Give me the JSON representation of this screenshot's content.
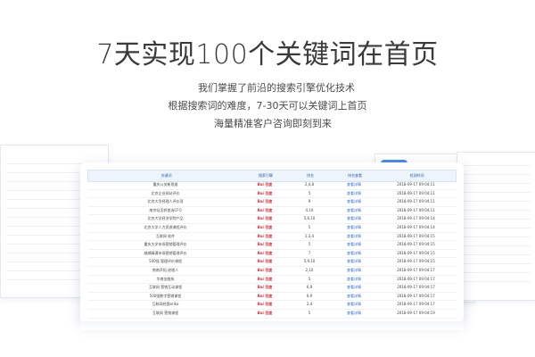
{
  "header": {
    "title": "7天实现100个关键词在首页",
    "subtitle_lines": [
      "我们掌握了前沿的搜索引擎优化技术",
      "根据搜索词的难度，7-30天可以关键词上首页",
      "海量精准客户咨询即刻到来"
    ]
  },
  "table": {
    "headers": [
      "关键词",
      "搜索引擎",
      "排名",
      "排名查看",
      "检测时间"
    ],
    "rows": [
      {
        "keyword": "重庆公关新思维",
        "engine": "Bai 百度",
        "rank": "2,4,8",
        "view": "查看详情",
        "time": "2018-09-17 09:04:11"
      },
      {
        "keyword": "北京企业网站评价",
        "engine": "Bai 百度",
        "rank": "5",
        "view": "查看详情",
        "time": "2018-09-17 09:04:11"
      },
      {
        "keyword": "北京大学经理人评价项",
        "engine": "Bai 百度",
        "rank": "9",
        "view": "查看详情",
        "time": "2018-09-17 09:04:11"
      },
      {
        "keyword": "南京站怎样首选CFO",
        "engine": "Bai 百度",
        "rank": "4,10",
        "view": "查看详情",
        "time": "2018-09-17 09:04:11"
      },
      {
        "keyword": "北京大学经济学院产品",
        "engine": "Bai 百度",
        "rank": "5,6,10",
        "view": "查看详情",
        "time": "2018-09-17 09:04:14"
      },
      {
        "keyword": "北京大学人力资源课程评价",
        "engine": "Bai 百度",
        "rank": "5",
        "view": "查看详情",
        "time": "2018-09-17 09:04:14"
      },
      {
        "keyword": "互联网 软件",
        "engine": "Bai 百度",
        "rank": "1,3,4",
        "view": "查看详情",
        "time": "2018-09-17 09:04:15"
      },
      {
        "keyword": "重庆大学市场营销管理评价",
        "engine": "Bai 百度",
        "rank": "5",
        "view": "查看详情",
        "time": "2018-09-17 09:04:15"
      },
      {
        "keyword": "威威精通市场营销管理评价",
        "engine": "Bai 百度",
        "rank": "7",
        "view": "查看详情",
        "time": "2018-09-17 09:04:15"
      },
      {
        "keyword": "500强 管理评价课程",
        "engine": "Bai 百度",
        "rank": "5,9,10",
        "view": "查看详情",
        "time": "2018-09-17 09:04:15"
      },
      {
        "keyword": "南南开拓 经理人",
        "engine": "Bai 百度",
        "rank": "2,10",
        "view": "查看详情",
        "time": "2018-09-17 09:04:17"
      },
      {
        "keyword": "华南金融系",
        "engine": "Bai 百度",
        "rank": "5",
        "view": "查看详情",
        "time": "2018-09-17 09:04:17"
      },
      {
        "keyword": "互联网 营销互动课程",
        "engine": "Bai 百度",
        "rank": "6,9",
        "view": "查看详情",
        "time": "2018-09-17 09:04:17"
      },
      {
        "keyword": "500强数字营销课程",
        "engine": "Bai 百度",
        "rank": "6,9",
        "view": "查看详情",
        "time": "2018-09-17 09:04:17"
      },
      {
        "keyword": "互联网经营erika",
        "engine": "Bai 百度",
        "rank": "2,4",
        "view": "查看详情",
        "time": "2018-09-17 09:04:17"
      },
      {
        "keyword": "互联网 营销课程",
        "engine": "Bai 百度",
        "rank": "5",
        "view": "查看详情",
        "time": "2018-09-17 09:04:19"
      }
    ]
  },
  "colors": {
    "header_bg": "#eef4fb",
    "header_text": "#2f61a8",
    "baidu_red": "#d1363a",
    "link_blue": "#2f6ac6"
  }
}
